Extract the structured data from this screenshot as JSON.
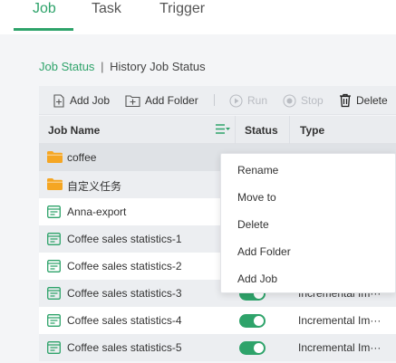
{
  "tabs": [
    {
      "label": "Job"
    },
    {
      "label": "Task"
    },
    {
      "label": "Trigger"
    }
  ],
  "subnav": {
    "job_status": "Job Status",
    "separator": "|",
    "history_job_status": "History Job Status"
  },
  "toolbar": {
    "add_job": "Add Job",
    "add_folder": "Add Folder",
    "divider": "|",
    "run": "Run",
    "stop": "Stop",
    "delete": "Delete"
  },
  "table": {
    "columns": [
      "Job Name",
      "Status",
      "Type"
    ],
    "rows": [
      {
        "name": "coffee",
        "kind": "folder"
      },
      {
        "name": "自定义任务",
        "kind": "folder"
      },
      {
        "name": "Anna-export",
        "kind": "job"
      },
      {
        "name": "Coffee sales statistics-1",
        "kind": "job"
      },
      {
        "name": "Coffee sales statistics-2",
        "kind": "job"
      },
      {
        "name": "Coffee sales statistics-3",
        "kind": "job",
        "status": "on",
        "type": "Incremental Im···"
      },
      {
        "name": "Coffee sales statistics-4",
        "kind": "job",
        "status": "on",
        "type": "Incremental Im···"
      },
      {
        "name": "Coffee sales statistics-5",
        "kind": "job",
        "status": "on",
        "type": "Incremental Im···"
      }
    ]
  },
  "context_menu": {
    "items": [
      "Rename",
      "Move to",
      "Delete",
      "Add Folder",
      "Add Job"
    ]
  },
  "colors": {
    "accent": "#2ea36a",
    "folder": "#f5a623"
  },
  "icons": {
    "folder": "folder-icon",
    "job": "job-icon",
    "filter": "filter-icon",
    "add_job": "add-job-icon",
    "add_folder": "add-folder-icon",
    "run": "play-icon",
    "stop": "stop-icon",
    "delete": "trash-icon"
  }
}
